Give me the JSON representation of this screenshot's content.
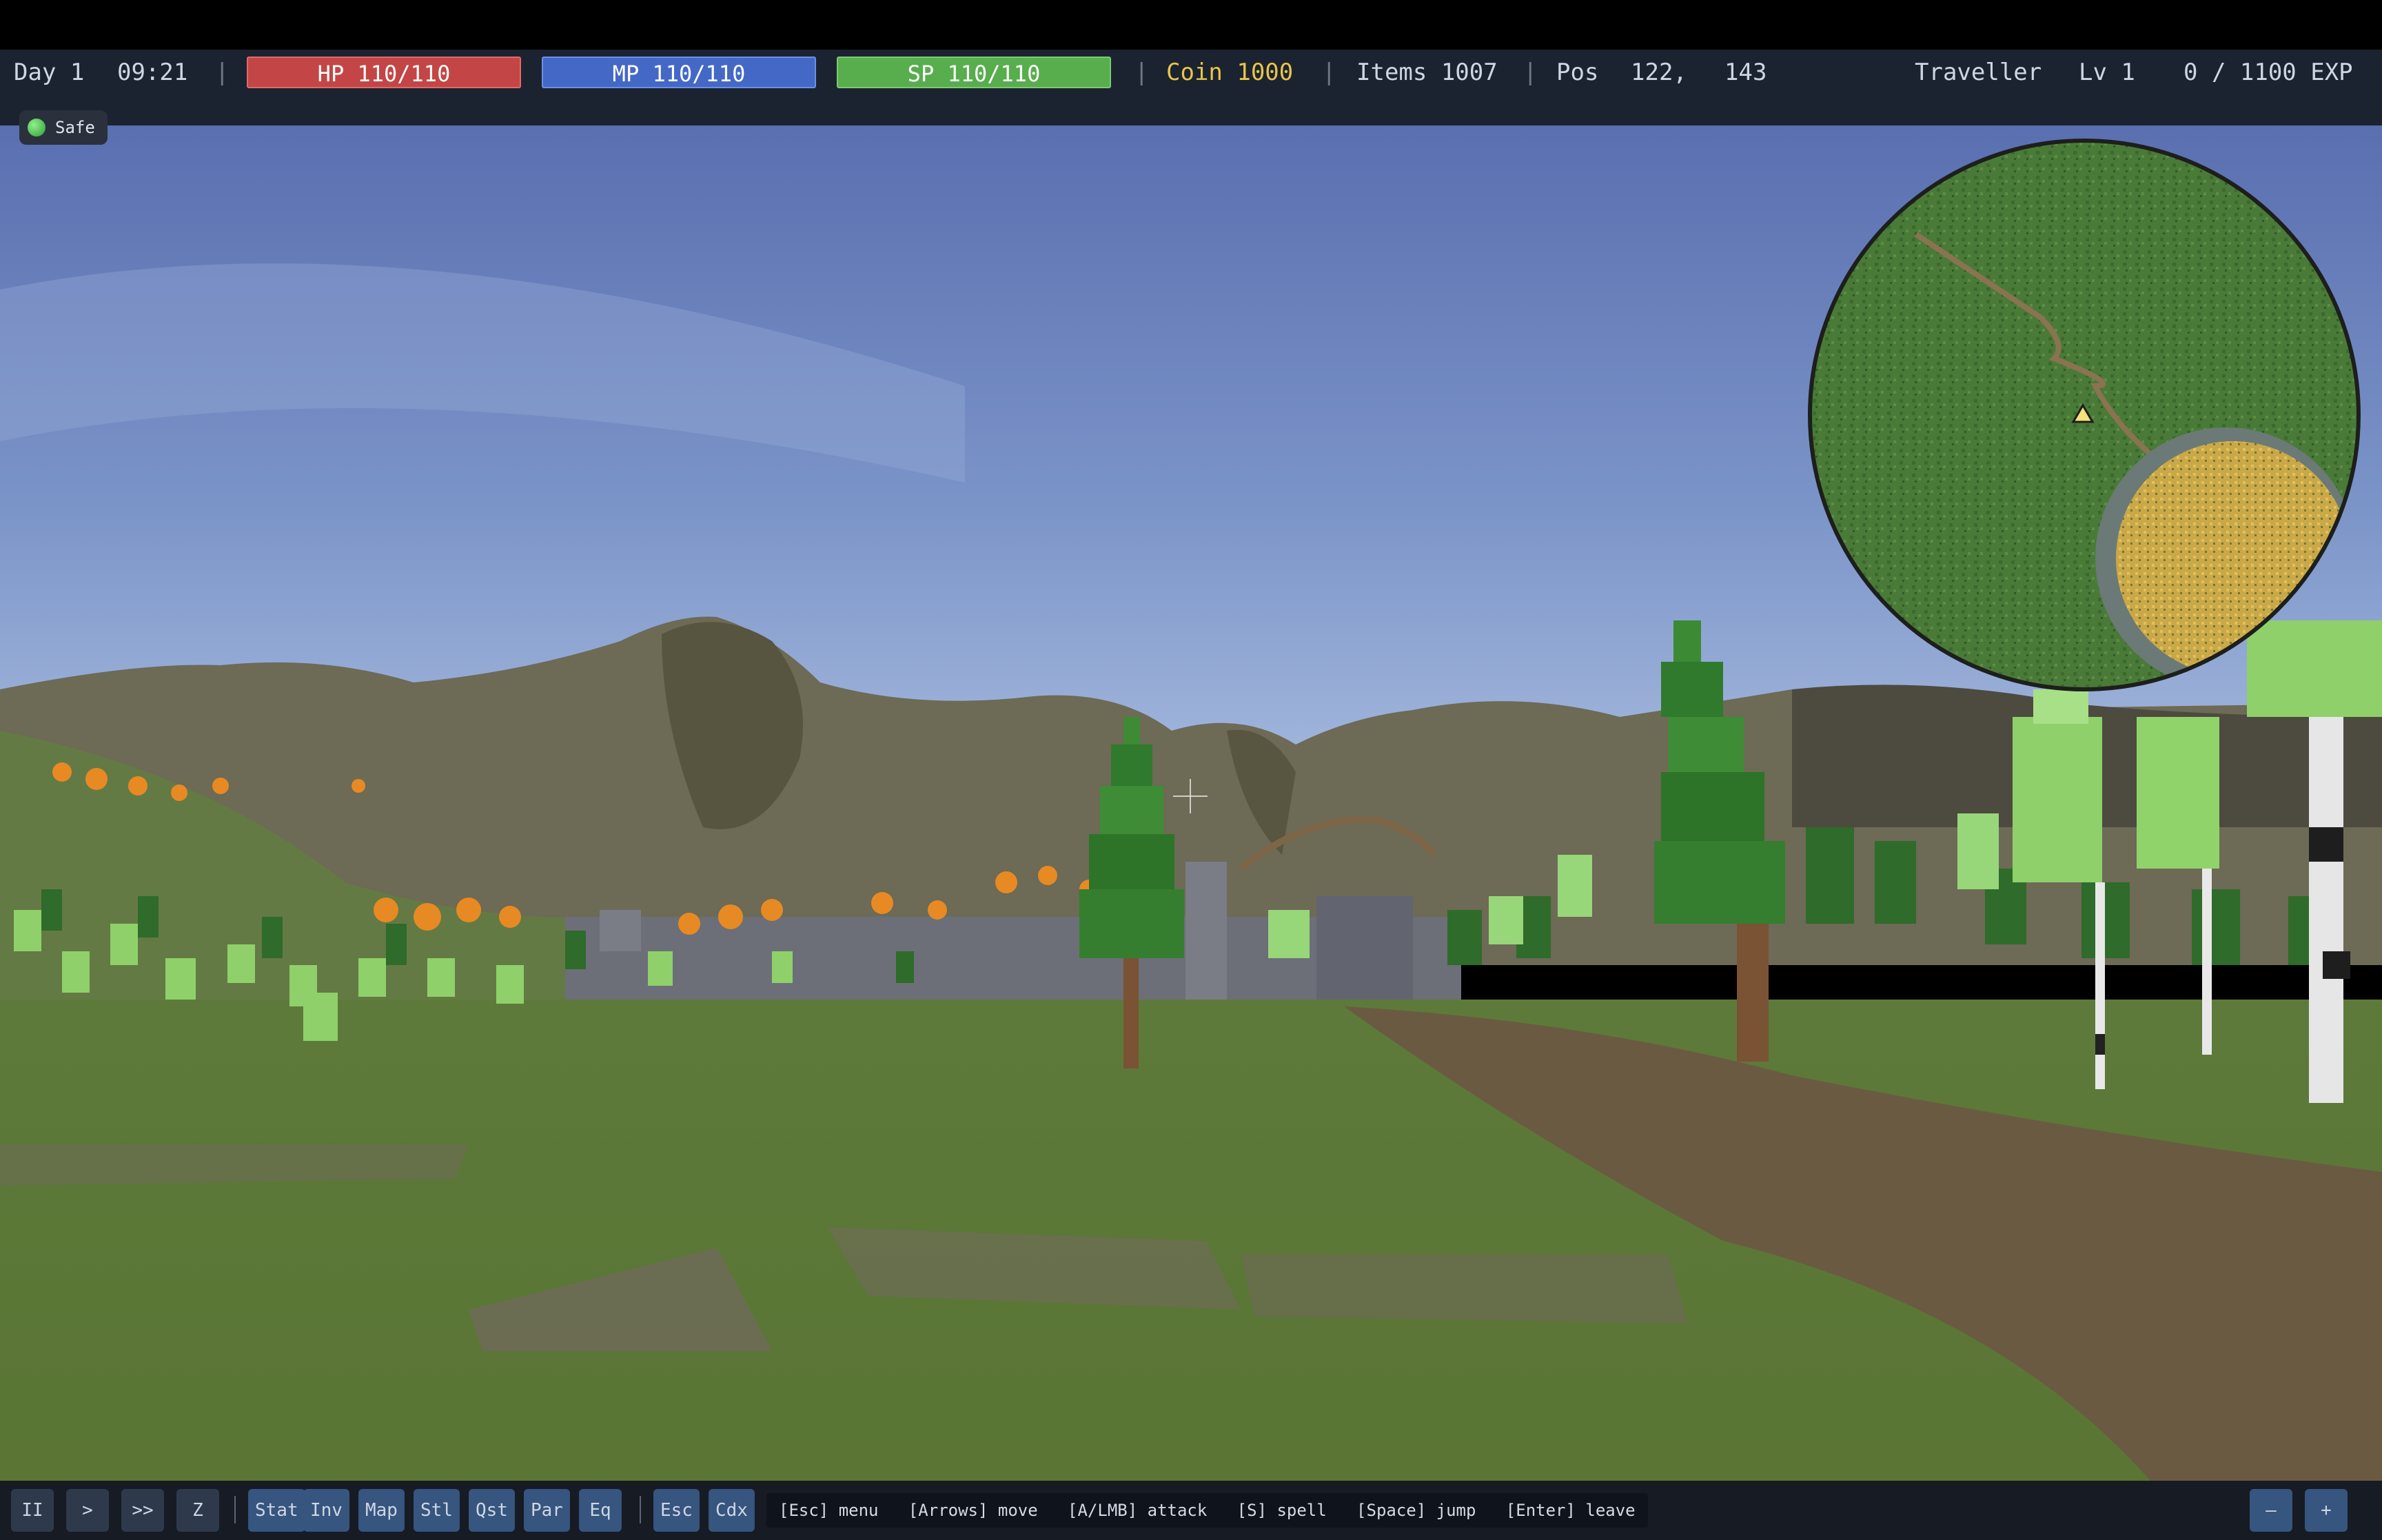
{
  "hud": {
    "day": "Day 1",
    "time": "09:21",
    "hp": "HP 110/110",
    "mp": "MP 110/110",
    "sp": "SP 110/110",
    "coin": "Coin 1000",
    "items": "Items 1007",
    "pos_label": "Pos",
    "pos_x": "122,",
    "pos_y": "143",
    "char_class": "Traveller",
    "level": "Lv 1",
    "exp": "0 / 1100 EXP"
  },
  "status": {
    "safe_label": "Safe"
  },
  "toolbar": {
    "speed": [
      "II",
      ">",
      ">>",
      "Z"
    ],
    "menus": [
      "Stat",
      "Inv",
      "Map",
      "Stl",
      "Qst",
      "Par",
      "Eq"
    ],
    "system": [
      "Esc",
      "Cdx"
    ],
    "zoom_out": "–",
    "zoom_in": "+",
    "hints": "[Esc] menu   [Arrows] move   [A/LMB] attack   [S] spell   [Space] jump   [Enter] leave"
  },
  "colors": {
    "hp": "#c44545",
    "mp": "#4468c6",
    "sp": "#58ad4d",
    "coin": "#e7c54a",
    "hud_bg": "#1c2330"
  }
}
